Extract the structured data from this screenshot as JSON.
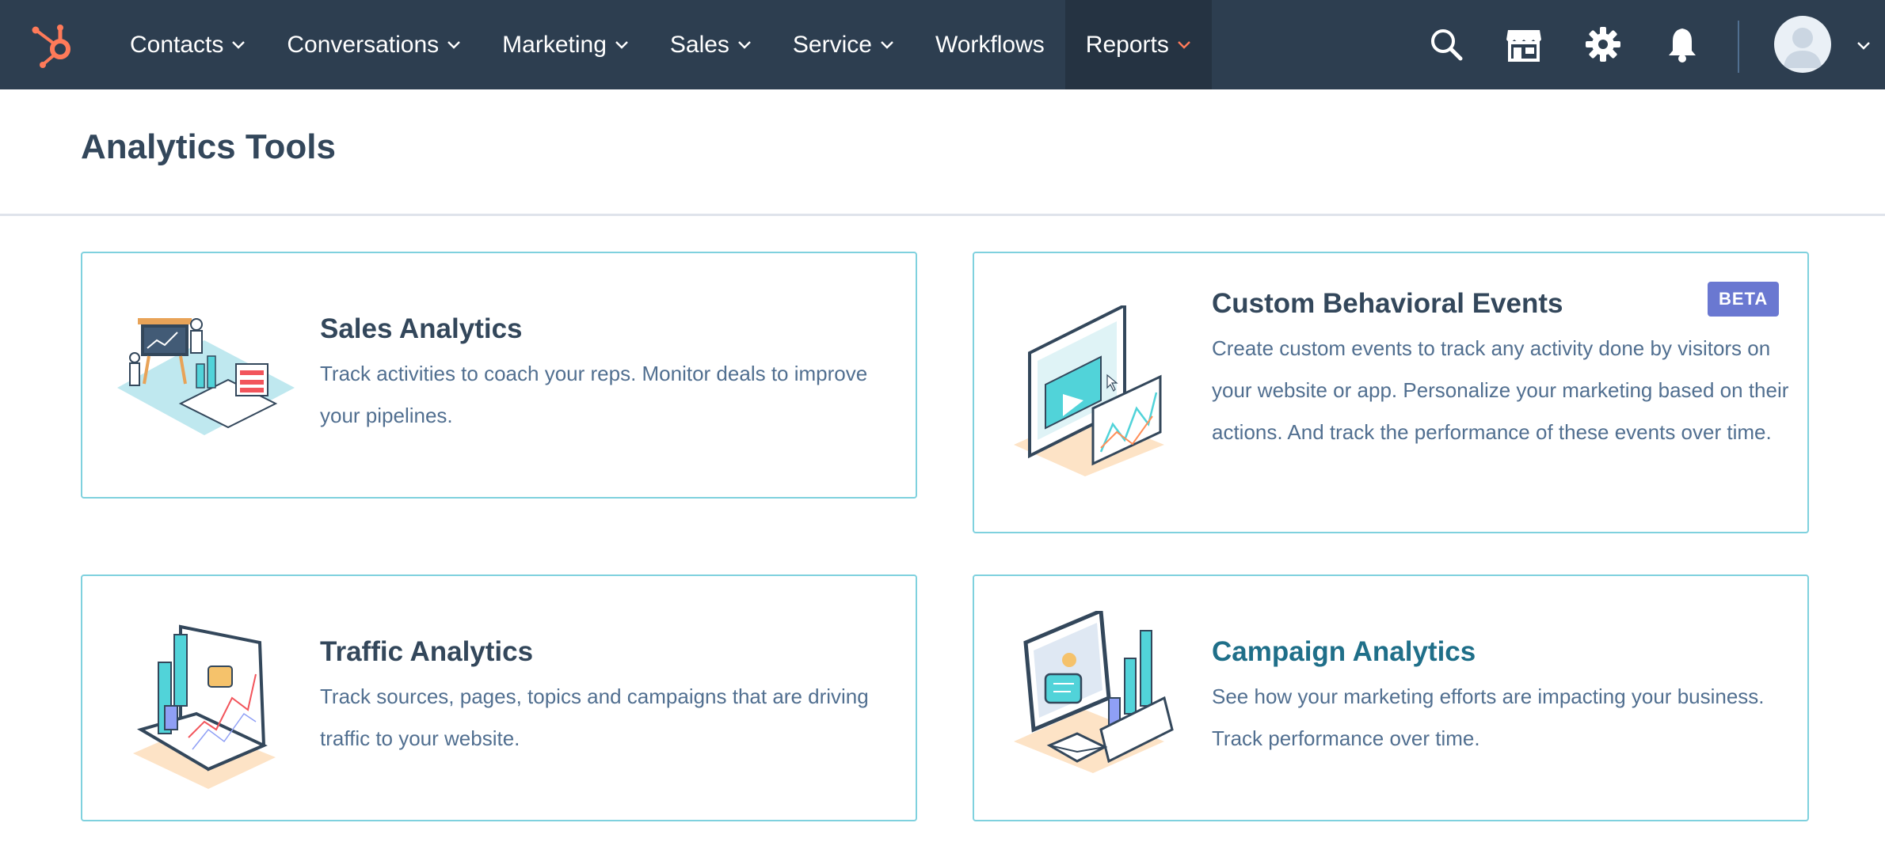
{
  "nav": {
    "items": [
      {
        "label": "Contacts",
        "dropdown": true
      },
      {
        "label": "Conversations",
        "dropdown": true
      },
      {
        "label": "Marketing",
        "dropdown": true
      },
      {
        "label": "Sales",
        "dropdown": true
      },
      {
        "label": "Service",
        "dropdown": true
      },
      {
        "label": "Workflows",
        "dropdown": false
      },
      {
        "label": "Reports",
        "dropdown": true,
        "active": true
      }
    ],
    "icons": [
      "search-icon",
      "marketplace-icon",
      "settings-gear-icon",
      "notifications-bell-icon"
    ],
    "accent_color": "#ff7a59"
  },
  "page": {
    "title": "Analytics Tools"
  },
  "cards": [
    {
      "title": "Sales Analytics",
      "description": "Track activities to coach your reps. Monitor deals to improve your pipelines."
    },
    {
      "title": "Custom Behavioral Events",
      "badge": "BETA",
      "description": "Create custom events to track any activity done by visitors on your website or app. Personalize your marketing based on their actions. And track the performance of these events over time."
    },
    {
      "title": "Traffic Analytics",
      "description": "Track sources, pages, topics and campaigns that are driving traffic to your website."
    },
    {
      "title": "Campaign Analytics",
      "description": "See how your marketing efforts are impacting your business. Track performance over time."
    }
  ]
}
